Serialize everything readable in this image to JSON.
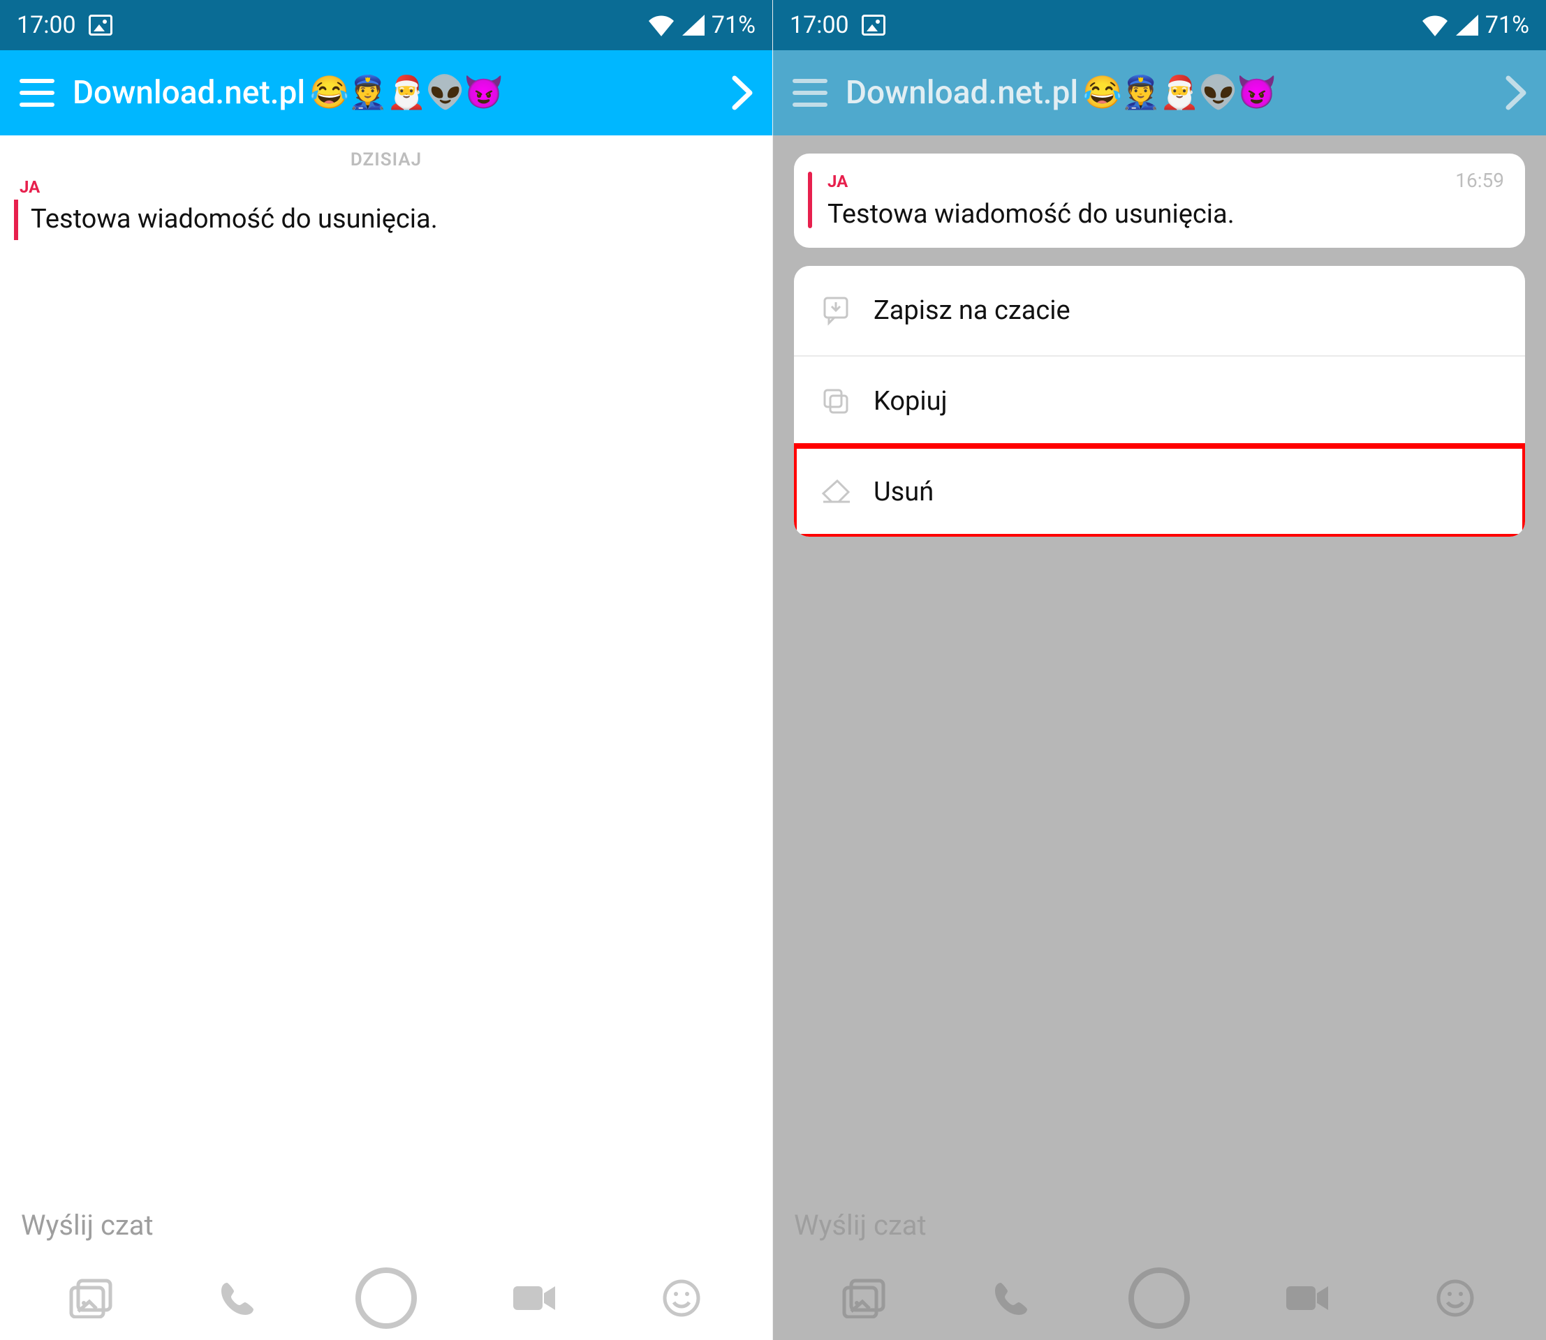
{
  "status": {
    "time": "17:00",
    "battery": "71%"
  },
  "chat": {
    "title": "Download.net.pl",
    "emojis": "😂👮🎅👽😈"
  },
  "left": {
    "date_label": "DZISIAJ",
    "sender": "JA",
    "message": "Testowa wiadomość do usunięcia."
  },
  "right": {
    "sender": "JA",
    "time": "16:59",
    "message": "Testowa wiadomość do usunięcia.",
    "menu": {
      "save": "Zapisz na czacie",
      "copy": "Kopiuj",
      "delete": "Usuń"
    }
  },
  "input": {
    "placeholder": "Wyślij czat"
  }
}
